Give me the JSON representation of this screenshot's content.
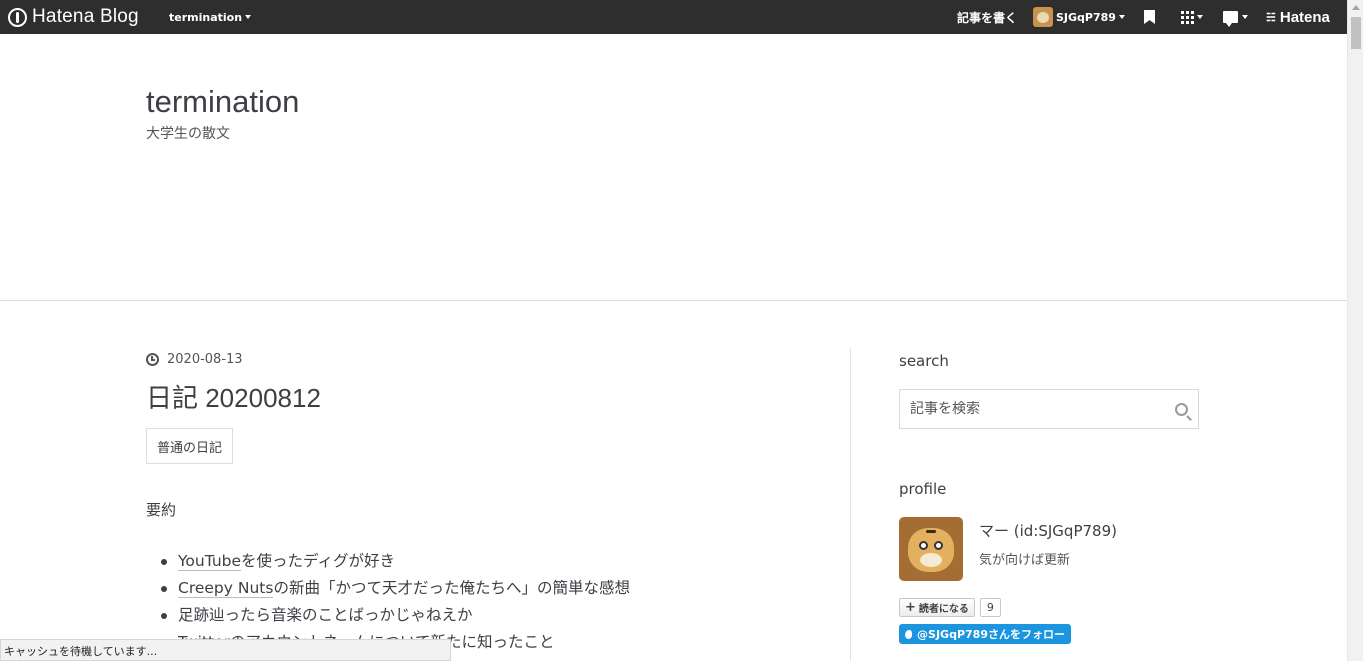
{
  "topbar": {
    "logo_text": "Hatena Blog",
    "blog_name": "termination",
    "write_label": "記事を書く",
    "user_name": "SJGqP789",
    "hatena_label": "Hatena"
  },
  "header": {
    "title": "termination",
    "description": "大学生の散文"
  },
  "entry": {
    "date": "2020-08-13",
    "title": "日記 20200812",
    "category": "普通の日記",
    "section_heading": "要約",
    "bullets": [
      {
        "kw": "YouTube",
        "rest": "を使ったディグが好き"
      },
      {
        "kw": "Creepy Nuts",
        "rest": "の新曲「かつて天才だった俺たちへ」の簡単な感想"
      },
      {
        "kw": "",
        "rest": "足跡辿ったら音楽のことばっかじゃねえか"
      },
      {
        "kw": "",
        "rest": "Twitterのアカウントネームについて新たに知ったこと"
      }
    ]
  },
  "status_bar": "キャッシュを待機しています...",
  "sidebar": {
    "search": {
      "title": "search",
      "placeholder": "記事を検索"
    },
    "profile": {
      "title": "profile",
      "name": "マー (id:SJGqP789)",
      "description": "気が向けば更新",
      "subscribe_label": "読者になる",
      "subscriber_count": "9",
      "twitter_label": "@SJGqP789さんをフォロー"
    }
  },
  "colors": {
    "topbar_bg": "#2e2e2e",
    "text": "#3d3f44",
    "twitter_blue": "#1b95e0"
  },
  "icons": [
    "hatena-blog-logo-icon",
    "caret-down-icon",
    "bookmark-icon",
    "apps-grid-icon",
    "notification-icon",
    "hatena-logo-icon",
    "clock-icon",
    "search-icon",
    "twitter-bird-icon",
    "plus-icon"
  ]
}
